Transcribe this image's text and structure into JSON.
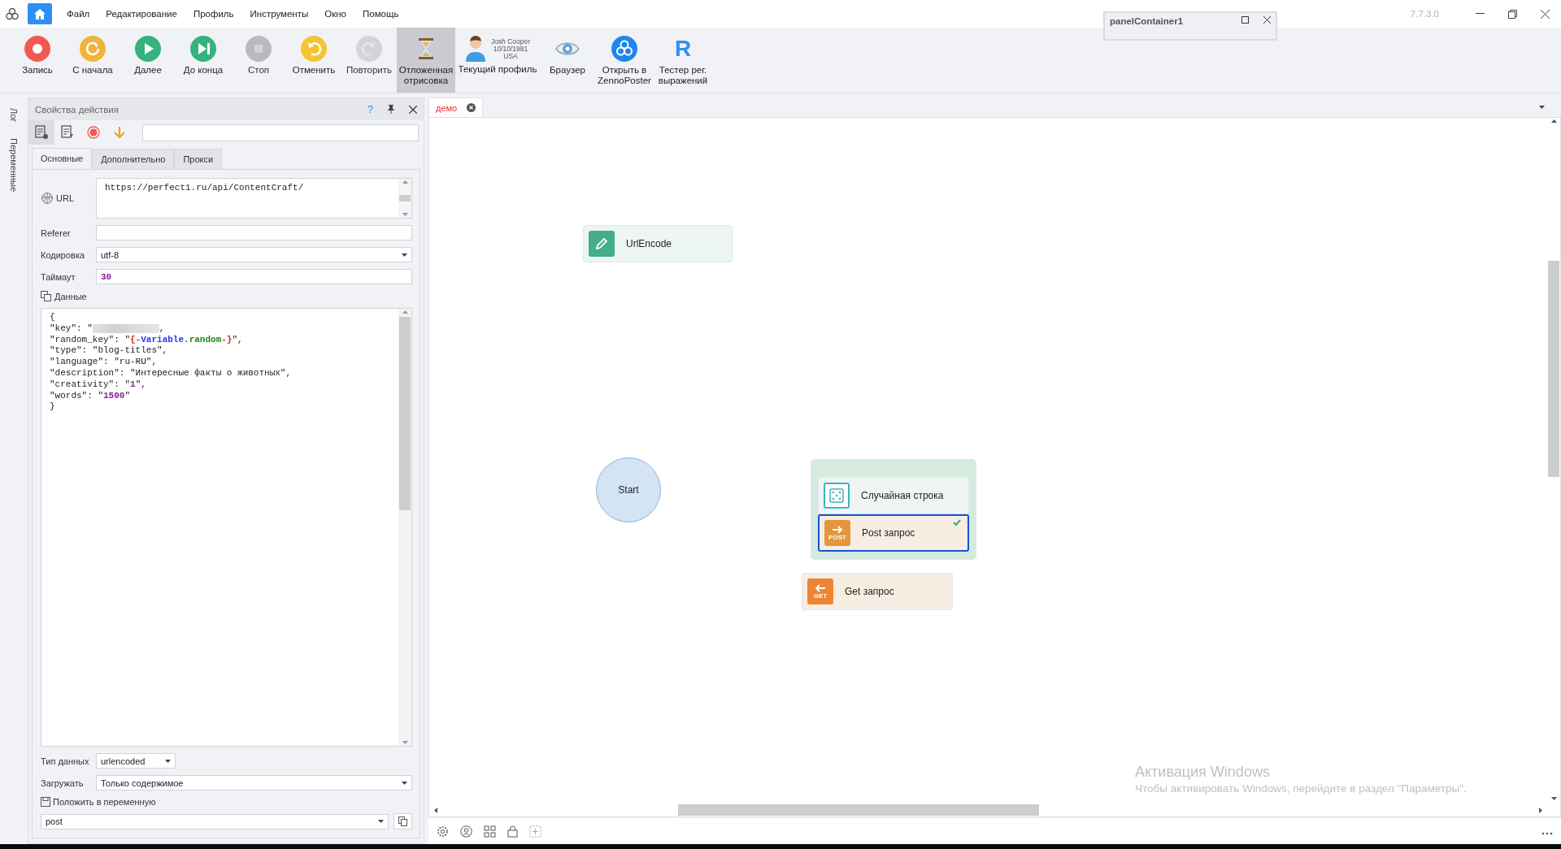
{
  "menu": {
    "items": [
      "Файл",
      "Редактирование",
      "Профиль",
      "Инструменты",
      "Окно",
      "Помощь"
    ],
    "version": "7.7.3.0"
  },
  "floating_panel": {
    "title": "panelContainer1"
  },
  "toolbar": [
    {
      "kind": "record",
      "label": "Запись",
      "disabled": false,
      "selected": false
    },
    {
      "kind": "restart",
      "label": "С начала",
      "disabled": false,
      "selected": false
    },
    {
      "kind": "play",
      "label": "Далее",
      "disabled": false,
      "selected": false
    },
    {
      "kind": "skip",
      "label": "До конца",
      "disabled": false,
      "selected": false
    },
    {
      "kind": "stop",
      "label": "Стоп",
      "disabled": true,
      "selected": false
    },
    {
      "kind": "undo",
      "label": "Отменить",
      "disabled": false,
      "selected": false
    },
    {
      "kind": "redo",
      "label": "Повторить",
      "disabled": true,
      "selected": false
    },
    {
      "kind": "hourglass",
      "label": "Отложенная отрисовка",
      "disabled": false,
      "selected": true
    },
    {
      "kind": "profile",
      "label": "Текущий профиль",
      "name": "Josh Cooper",
      "date": "10/10/1981",
      "country": "USA"
    },
    {
      "kind": "eye",
      "label": "Браузер",
      "disabled": false,
      "selected": false
    },
    {
      "kind": "logo",
      "label": "Открыть в ZennoPoster",
      "disabled": false,
      "selected": false
    },
    {
      "kind": "regex",
      "label": "Тестер рег. выражений",
      "icon_text": "R",
      "disabled": false,
      "selected": false
    }
  ],
  "side_tabs": [
    "Лог",
    "Переменные"
  ],
  "properties": {
    "title": "Свойства действия",
    "help": "?",
    "tabs": [
      {
        "label": "Основные",
        "selected": true
      },
      {
        "label": "Дополнительно",
        "selected": false
      },
      {
        "label": "Прокси",
        "selected": false
      }
    ],
    "url": {
      "label": "URL",
      "value": "https://perfect1.ru/api/ContentCraft/"
    },
    "referer": {
      "label": "Referer"
    },
    "encoding": {
      "label": "Кодировка",
      "value": "utf-8"
    },
    "timeout": {
      "label": "Таймаут",
      "value": "30"
    },
    "data": {
      "label": "Данные",
      "lines": [
        [
          {
            "text": "{"
          }
        ],
        [
          {
            "text": "\"key\": \""
          },
          {
            "kind": "redacted"
          },
          {
            "text": ","
          }
        ],
        [
          {
            "text": "\"random_key\": \""
          },
          {
            "text": "{-",
            "color": "#e8191b"
          },
          {
            "text": "Variable.",
            "color": "#1f33ff"
          },
          {
            "text": "random",
            "color": "#1a8a1a"
          },
          {
            "text": "-}",
            "color": "#e8191b"
          },
          {
            "text": "\","
          }
        ],
        [
          {
            "text": "\"type\": \"blog-titles\","
          }
        ],
        [
          {
            "text": "\"language\": \"ru-RU\","
          }
        ],
        [
          {
            "text": "\"description\": \"Интересные факты о животных\","
          }
        ],
        [
          {
            "text": "\"creativity\": \""
          },
          {
            "text": "1",
            "color": "#8a1a9a"
          },
          {
            "text": "\","
          }
        ],
        [
          {
            "text": "\"words\": \""
          },
          {
            "text": "1500",
            "color": "#8a1a9a"
          },
          {
            "text": "\""
          }
        ],
        [
          {
            "text": "}"
          }
        ]
      ]
    },
    "data_type": {
      "label": "Тип данных",
      "value": "urlencoded"
    },
    "load": {
      "label": "Загружать",
      "value": "Только содержимое"
    },
    "save_to": {
      "label": "Положить в переменную",
      "value": "post"
    }
  },
  "canvas": {
    "tab": "демо",
    "nodes": [
      {
        "kind": "urlencode",
        "label": "UrlEncode",
        "selected": false
      },
      {
        "kind": "start",
        "label": "Start",
        "selected": false
      },
      {
        "kind": "random",
        "label": "Случайная строка",
        "selected": false
      },
      {
        "kind": "post",
        "label": "Post запрос",
        "badge": "POST",
        "selected": true,
        "checked": true
      },
      {
        "kind": "get",
        "label": "Get запрос",
        "badge": "GET",
        "selected": false
      }
    ]
  },
  "activation": {
    "title": "Активация Windows",
    "text": "Чтобы активировать Windows, перейдите в раздел \"Параметры\"."
  }
}
